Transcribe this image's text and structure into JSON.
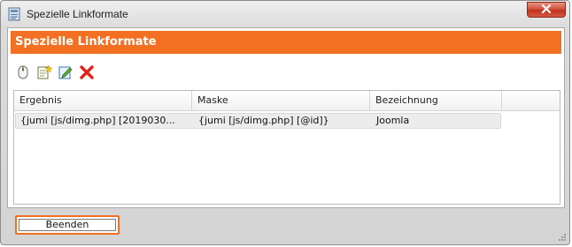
{
  "window": {
    "title": "Spezielle Linkformate",
    "app_icon": "document-icon",
    "close_icon": "close-icon"
  },
  "panel": {
    "title": "Spezielle Linkformate",
    "accent_color": "#f36f21"
  },
  "toolbar": {
    "buttons": [
      {
        "icon": "mouse-icon"
      },
      {
        "icon": "new-document-icon"
      },
      {
        "icon": "edit-icon"
      },
      {
        "icon": "delete-icon"
      }
    ]
  },
  "grid": {
    "columns": [
      "Ergebnis",
      "Maske",
      "Bezeichnung"
    ],
    "rows": [
      {
        "ergebnis": "{jumi [js/dimg.php] [2019030...",
        "maske": "{jumi [js/dimg.php] [@id]}",
        "bezeichnung": "Joomla"
      }
    ]
  },
  "footer": {
    "close_button_label": "Beenden"
  }
}
